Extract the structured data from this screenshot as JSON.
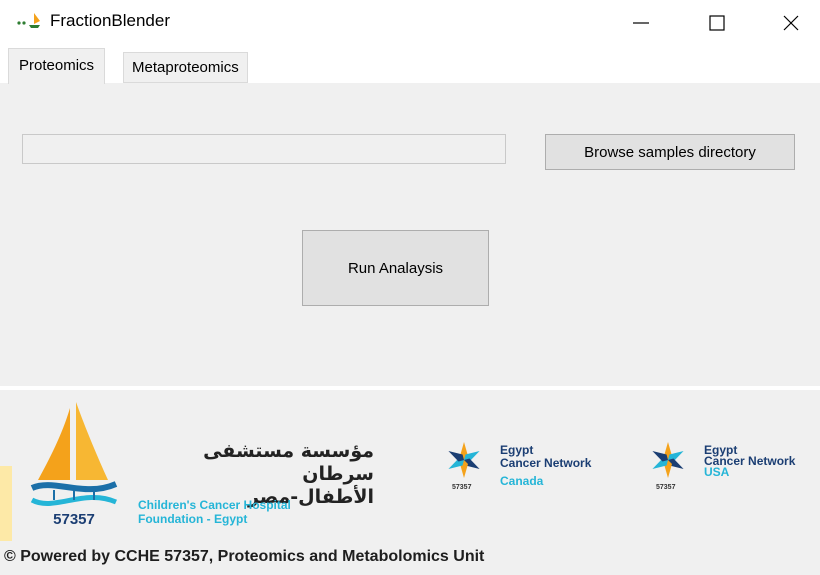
{
  "window": {
    "title": "FractionBlender",
    "icon": "app-icon",
    "controls": [
      "minimize-icon",
      "maximize-icon",
      "close-icon"
    ]
  },
  "tabs": [
    {
      "label": "Proteomics",
      "active": true
    },
    {
      "label": "Metaproteomics",
      "active": false
    }
  ],
  "proteomics": {
    "samples_path": "",
    "browse_label": "Browse samples directory",
    "run_label": "Run Analaysis"
  },
  "footer": {
    "logo_number": "57357",
    "arabic_line1": "مؤسسة مستشفى سرطان",
    "arabic_line2": "الأطفال-مصر",
    "english_line1": "Children's Cancer Hospital",
    "english_line2": "Foundation - Egypt",
    "networks": [
      {
        "line1": "Egypt",
        "line2": "Cancer Network",
        "country": "Canada",
        "code": "57357"
      },
      {
        "line1": "Egypt",
        "line2": "Cancer Network",
        "country": "USA",
        "code": "57357"
      }
    ],
    "powered_by": "© Powered by CCHE 57357, Proteomics and Metabolomics Unit"
  },
  "colors": {
    "panel": "#f0f0f0",
    "button": "#e1e1e1",
    "brand_navy": "#1b3e73",
    "brand_cyan": "#25b5d7",
    "brand_orange": "#f4a21b"
  }
}
